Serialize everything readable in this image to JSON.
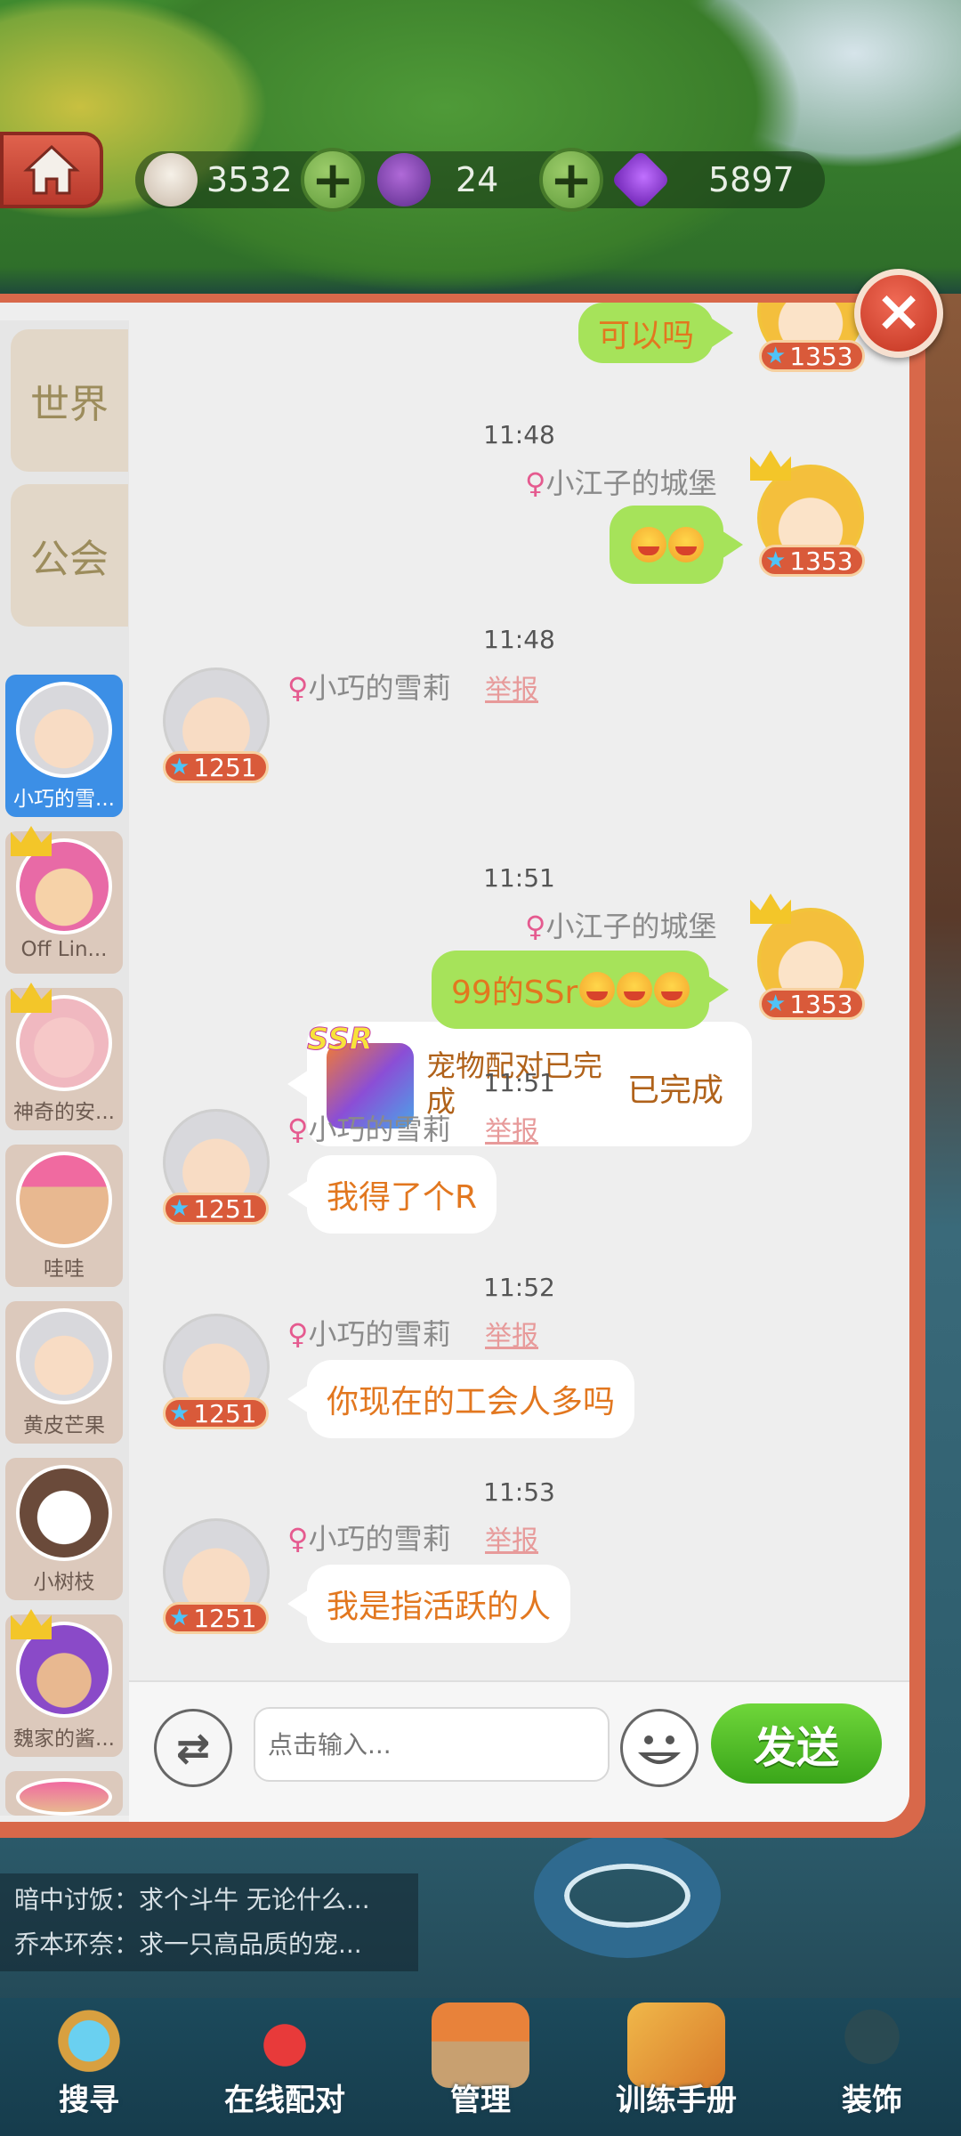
{
  "resources": {
    "milk": "3532",
    "yarn": "24",
    "gems": "5897"
  },
  "tabs": [
    "世界",
    "公会"
  ],
  "contacts": [
    {
      "name": "小巧的雪..."
    },
    {
      "name": "Off Lin..."
    },
    {
      "name": "神奇的安..."
    },
    {
      "name": "哇哇"
    },
    {
      "name": "黄皮芒果"
    },
    {
      "name": "小树枝"
    },
    {
      "name": "魏家的酱..."
    }
  ],
  "messages": {
    "m0": {
      "text": "可以吗",
      "level": "1353"
    },
    "m1": {
      "time": "11:48",
      "sender": "小江子的城堡",
      "level": "1353"
    },
    "m2": {
      "time": "11:48",
      "sender": "小巧的雪莉",
      "report": "举报",
      "level": "1251",
      "card_badge": "SSR",
      "card_title": "宠物配对已完成",
      "card_status": "已完成"
    },
    "m3": {
      "time": "11:51",
      "sender": "小江子的城堡",
      "text": "99的SSr",
      "level": "1353"
    },
    "m4": {
      "time": "11:51",
      "sender": "小巧的雪莉",
      "report": "举报",
      "text": "我得了个R",
      "level": "1251"
    },
    "m5": {
      "time": "11:52",
      "sender": "小巧的雪莉",
      "report": "举报",
      "text": "你现在的工会人多吗",
      "level": "1251"
    },
    "m6": {
      "time": "11:53",
      "sender": "小巧的雪莉",
      "report": "举报",
      "text": "我是指活跃的人",
      "level": "1251"
    }
  },
  "input": {
    "placeholder": "点击输入...",
    "send_label": "发送"
  },
  "ticker": [
    "暗中讨饭：求个斗牛 无论什么...",
    "乔本环奈：求一只高品质的宠..."
  ],
  "nav": [
    "搜寻",
    "在线配对",
    "管理",
    "训练手册",
    "装饰"
  ]
}
